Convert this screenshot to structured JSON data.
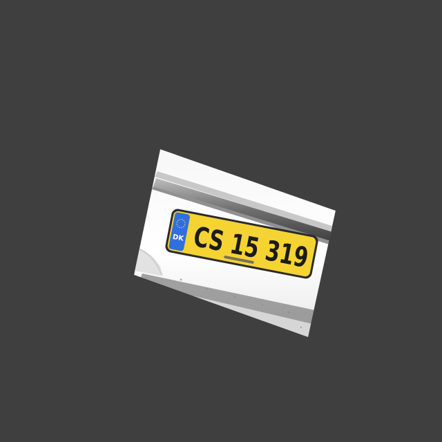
{
  "scene": {
    "description_label": "",
    "background_color": "#3f3f3f",
    "car_color": "#f2f2f2"
  },
  "plate": {
    "country_code": "DK",
    "registration": "CS 15 319",
    "plate_color": "#f5d332",
    "band_color": "#2f6fe0"
  }
}
